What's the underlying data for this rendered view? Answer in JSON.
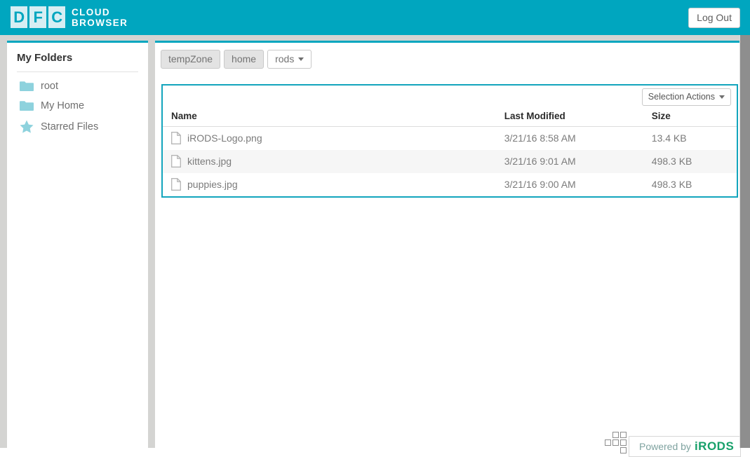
{
  "header": {
    "logo_letters": [
      "D",
      "F",
      "C"
    ],
    "logo_line1": "CLOUD",
    "logo_line2": "BROWSER",
    "logout_label": "Log Out",
    "bg_color": "#00a6bf"
  },
  "sidebar": {
    "title": "My Folders",
    "items": [
      {
        "label": "root",
        "icon": "folder-icon"
      },
      {
        "label": "My Home",
        "icon": "folder-icon"
      },
      {
        "label": "Starred Files",
        "icon": "star-icon"
      }
    ],
    "accent_color": "#00a6bf"
  },
  "breadcrumb": {
    "items": [
      {
        "label": "tempZone",
        "current": false
      },
      {
        "label": "home",
        "current": false
      },
      {
        "label": "rods",
        "current": true
      }
    ]
  },
  "toolbar": {
    "selection_actions_label": "Selection Actions"
  },
  "table": {
    "columns": [
      "Name",
      "Last Modified",
      "Size"
    ],
    "rows": [
      {
        "name": "iRODS-Logo.png",
        "modified": "3/21/16 8:58 AM",
        "size": "13.4 KB",
        "icon": "file-icon"
      },
      {
        "name": "kittens.jpg",
        "modified": "3/21/16 9:01 AM",
        "size": "498.3 KB",
        "icon": "file-icon"
      },
      {
        "name": "puppies.jpg",
        "modified": "3/21/16 9:00 AM",
        "size": "498.3 KB",
        "icon": "file-icon"
      }
    ],
    "border_color": "#13a5bd"
  },
  "footer": {
    "powered_by": "Powered by",
    "brand": "iRODS",
    "brand_color": "#17a06a"
  }
}
